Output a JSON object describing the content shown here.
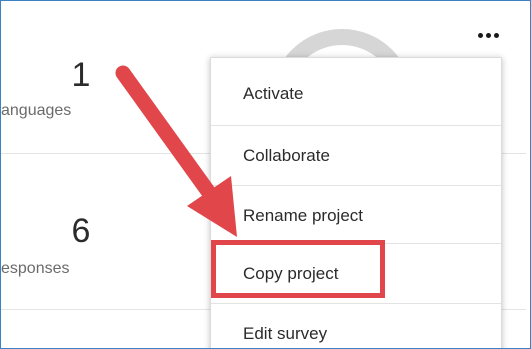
{
  "stats": [
    {
      "value": "1",
      "label": "anguages"
    },
    {
      "value": "6",
      "label": "esponses"
    }
  ],
  "menu": {
    "items": [
      {
        "label": "Activate"
      },
      {
        "label": "Collaborate"
      },
      {
        "label": "Rename project"
      },
      {
        "label": "Copy project"
      },
      {
        "label": "Edit survey"
      }
    ]
  },
  "annotation": {
    "arrow_color": "#e0464a",
    "highlight_color": "#e0464a",
    "highlighted_item": "Copy project"
  },
  "icons": {
    "more": "more-horizontal-icon"
  },
  "colors": {
    "frame_border": "#3b82c4",
    "gauge": "#d6d6d6"
  }
}
